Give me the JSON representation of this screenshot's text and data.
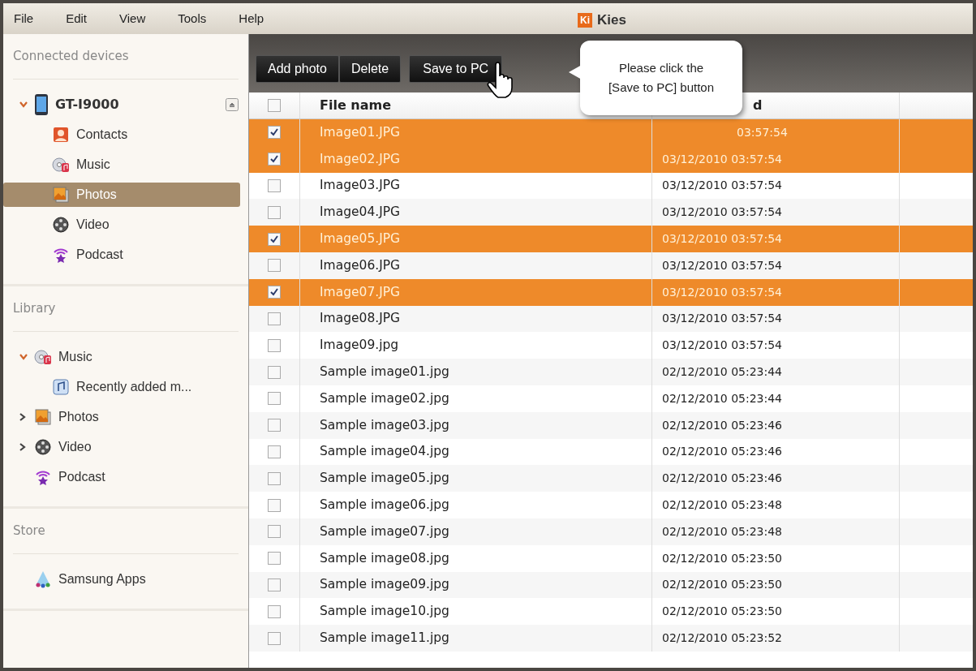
{
  "menu": [
    "File",
    "Edit",
    "View",
    "Tools",
    "Help"
  ],
  "app_title": {
    "logo": "Ki",
    "title": "Kies"
  },
  "sidebar": [
    {
      "heading": "Connected devices",
      "items": [
        {
          "label": "GT-I9000",
          "kind": "device",
          "expanded": true,
          "selected": false,
          "children": [
            {
              "label": "Contacts",
              "kind": "contacts",
              "selected": false
            },
            {
              "label": "Music",
              "kind": "music",
              "selected": false
            },
            {
              "label": "Photos",
              "kind": "photos",
              "selected": true
            },
            {
              "label": "Video",
              "kind": "video",
              "selected": false
            },
            {
              "label": "Podcast",
              "kind": "podcast",
              "selected": false
            }
          ]
        }
      ]
    },
    {
      "heading": "Library",
      "items": [
        {
          "label": "Music",
          "kind": "music",
          "expanded": true,
          "selected": false,
          "children": [
            {
              "label": "Recently added m...",
              "kind": "playlist",
              "selected": false
            }
          ]
        },
        {
          "label": "Photos",
          "kind": "photos",
          "expanded": false,
          "selected": false
        },
        {
          "label": "Video",
          "kind": "video",
          "expanded": false,
          "selected": false
        },
        {
          "label": "Podcast",
          "kind": "podcast",
          "selected": false
        }
      ]
    },
    {
      "heading": "Store",
      "items": [
        {
          "label": "Samsung Apps",
          "kind": "apps",
          "selected": false
        }
      ]
    }
  ],
  "toolbar": [
    {
      "label": "Add photo",
      "kind": "grouped"
    },
    {
      "label": "Delete",
      "kind": "grouped"
    },
    {
      "label": "Save to PC",
      "kind": "single"
    }
  ],
  "tooltip": [
    "Please click the",
    "[Save to PC] button"
  ],
  "table": {
    "header_checked": false,
    "columns": [
      {
        "label": "File name",
        "kind": "full"
      },
      {
        "label": "d",
        "kind": "covered"
      }
    ],
    "rows": [
      {
        "name": "Image01.JPG",
        "date": "03:57:54",
        "date_covered": true,
        "checked": true
      },
      {
        "name": "Image02.JPG",
        "date": "03/12/2010 03:57:54",
        "checked": true
      },
      {
        "name": "Image03.JPG",
        "date": "03/12/2010 03:57:54",
        "checked": false
      },
      {
        "name": "Image04.JPG",
        "date": "03/12/2010 03:57:54",
        "checked": false
      },
      {
        "name": "Image05.JPG",
        "date": "03/12/2010 03:57:54",
        "checked": true
      },
      {
        "name": "Image06.JPG",
        "date": "03/12/2010 03:57:54",
        "checked": false
      },
      {
        "name": "Image07.JPG",
        "date": "03/12/2010 03:57:54",
        "checked": true
      },
      {
        "name": "Image08.JPG",
        "date": "03/12/2010 03:57:54",
        "checked": false
      },
      {
        "name": "Image09.jpg",
        "date": "03/12/2010 03:57:54",
        "checked": false
      },
      {
        "name": "Sample image01.jpg",
        "date": "02/12/2010 05:23:44",
        "checked": false
      },
      {
        "name": "Sample image02.jpg",
        "date": "02/12/2010 05:23:44",
        "checked": false
      },
      {
        "name": "Sample image03.jpg",
        "date": "02/12/2010 05:23:46",
        "checked": false
      },
      {
        "name": "Sample image04.jpg",
        "date": "02/12/2010 05:23:46",
        "checked": false
      },
      {
        "name": "Sample image05.jpg",
        "date": "02/12/2010 05:23:46",
        "checked": false
      },
      {
        "name": "Sample image06.jpg",
        "date": "02/12/2010 05:23:48",
        "checked": false
      },
      {
        "name": "Sample image07.jpg",
        "date": "02/12/2010 05:23:48",
        "checked": false
      },
      {
        "name": "Sample image08.jpg",
        "date": "02/12/2010 05:23:50",
        "checked": false
      },
      {
        "name": "Sample image09.jpg",
        "date": "02/12/2010 05:23:50",
        "checked": false
      },
      {
        "name": "Sample image10.jpg",
        "date": "02/12/2010 05:23:50",
        "checked": false
      },
      {
        "name": "Sample image11.jpg",
        "date": "02/12/2010 05:23:52",
        "checked": false
      }
    ]
  }
}
